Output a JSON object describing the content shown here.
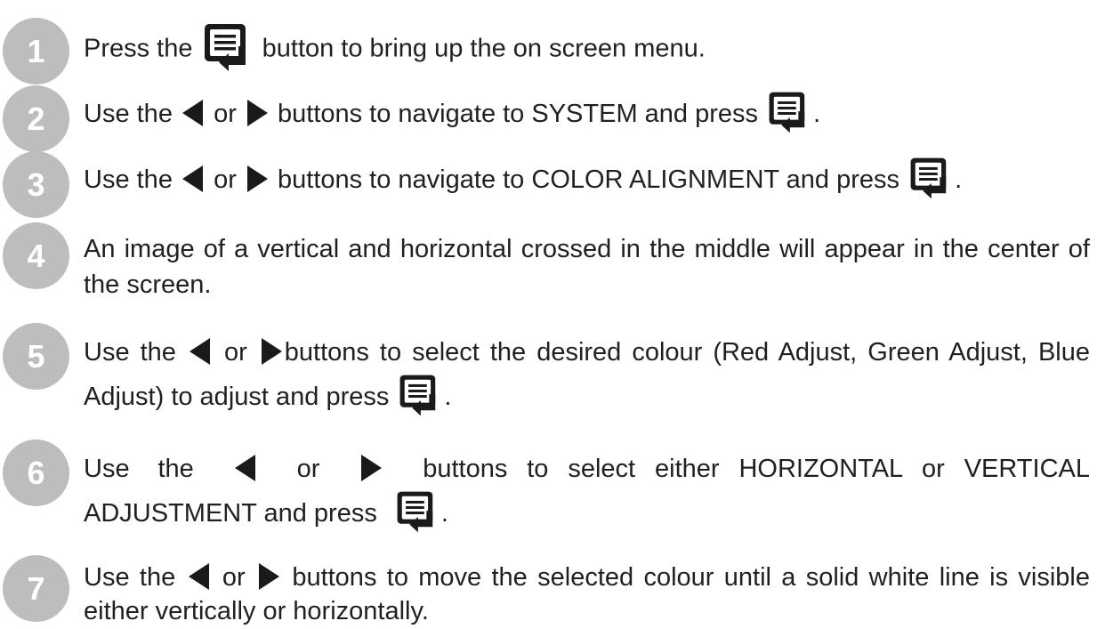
{
  "steps": [
    {
      "number": "1",
      "parts": [
        "Press the",
        "button to bring up the on screen menu."
      ]
    },
    {
      "number": "2",
      "parts": [
        "Use the",
        "or",
        "buttons to navigate to SYSTEM and press",
        "."
      ]
    },
    {
      "number": "3",
      "parts": [
        "Use the",
        "or",
        "buttons to navigate to COLOR ALIGNMENT and press",
        "."
      ]
    },
    {
      "number": "4",
      "parts": [
        "An image of a vertical and horizontal crossed in the middle will appear in the center of the screen."
      ]
    },
    {
      "number": "5",
      "parts": [
        "Use the",
        "or",
        "buttons to select the desired colour (Red Adjust, Green Adjust, Blue Adjust) to adjust and press",
        "."
      ]
    },
    {
      "number": "6",
      "parts": [
        "Use the",
        "or",
        "buttons to select either HORIZONTAL or VERTICAL ADJUSTMENT and press",
        "."
      ]
    },
    {
      "number": "7",
      "parts": [
        "Use the",
        "or",
        "buttons to move the selected colour until a solid white line is visible either vertically or horizontally."
      ]
    }
  ],
  "icons": {
    "menu": "menu-button-icon",
    "left": "left-arrow-icon",
    "right": "right-arrow-icon"
  },
  "colors": {
    "text": "#231f20",
    "step_circle": "#bdbdbd",
    "icon": "#1a1a1a"
  }
}
